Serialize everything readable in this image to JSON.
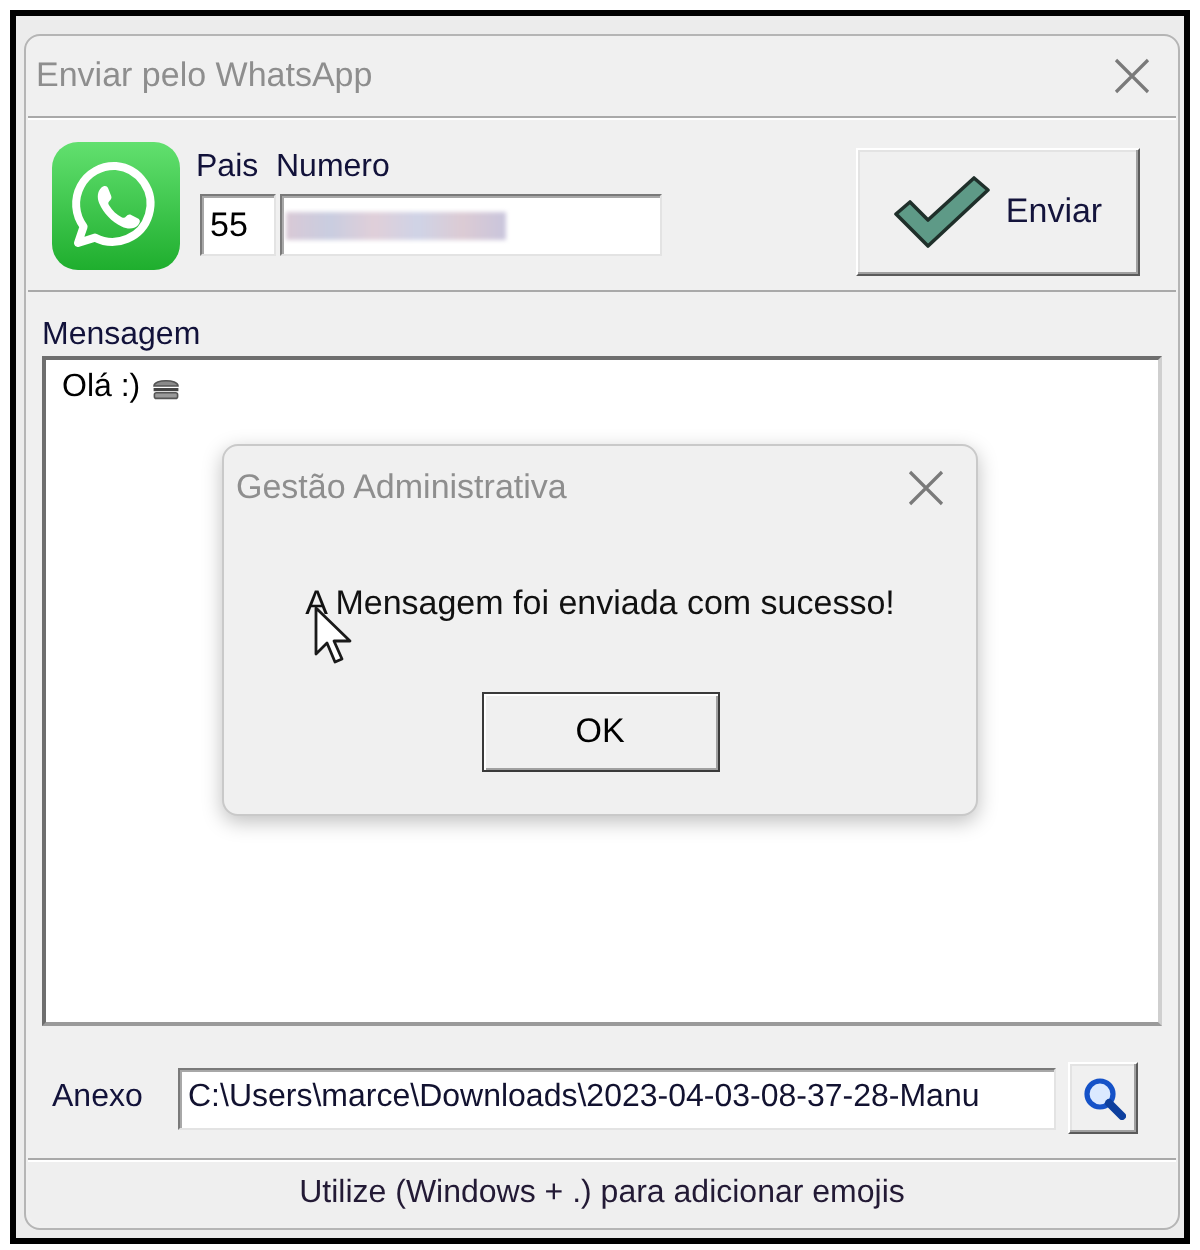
{
  "window": {
    "title": "Enviar pelo WhatsApp"
  },
  "phone": {
    "country_label": "Pais",
    "number_label": "Numero",
    "country_code": "55"
  },
  "send_button": {
    "label": "Enviar"
  },
  "message": {
    "label": "Mensagem",
    "value": "Olá :)"
  },
  "dialog": {
    "title": "Gestão Administrativa",
    "text": "A Mensagem foi enviada com sucesso!",
    "button": "OK"
  },
  "attachment": {
    "label": "Anexo",
    "value": "C:\\Users\\marce\\Downloads\\2023-04-03-08-37-28-Manu"
  },
  "status_bar": {
    "text": "Utilize (Windows + .) para adicionar emojis"
  }
}
